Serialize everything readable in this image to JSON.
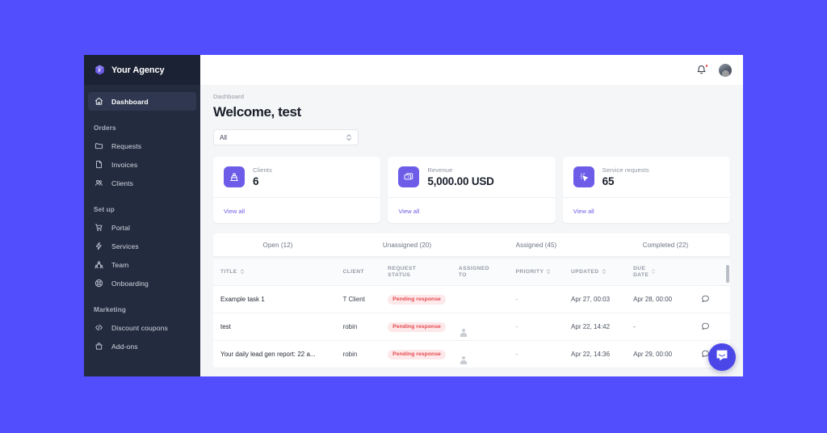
{
  "window": {
    "background_color": "#524EFD",
    "surface_color": "#f5f6f8"
  },
  "sidebar": {
    "brand": {
      "name": "Your Agency",
      "logo_icon": "cube-logo-icon"
    },
    "groups": [
      {
        "section": null,
        "items": [
          {
            "label": "Dashboard",
            "icon": "home-icon",
            "active": true
          }
        ]
      },
      {
        "section": "Orders",
        "items": [
          {
            "label": "Requests",
            "icon": "folder-icon",
            "active": false
          },
          {
            "label": "Invoices",
            "icon": "document-icon",
            "active": false
          },
          {
            "label": "Clients",
            "icon": "users-icon",
            "active": false
          }
        ]
      },
      {
        "section": "Set up",
        "items": [
          {
            "label": "Portal",
            "icon": "cart-icon",
            "active": false
          },
          {
            "label": "Services",
            "icon": "lightning-icon",
            "active": false
          },
          {
            "label": "Team",
            "icon": "team-icon",
            "active": false
          },
          {
            "label": "Onboarding",
            "icon": "lifebuoy-icon",
            "active": false
          }
        ]
      },
      {
        "section": "Marketing",
        "items": [
          {
            "label": "Discount coupons",
            "icon": "code-icon",
            "active": false
          },
          {
            "label": "Add-ons",
            "icon": "bag-icon",
            "active": false
          }
        ]
      }
    ]
  },
  "topbar": {
    "notifications_icon": "bell-icon",
    "has_unread": true,
    "avatar": "user-avatar"
  },
  "page": {
    "breadcrumb": "Dashboard",
    "title": "Welcome, test"
  },
  "filter": {
    "value": "All",
    "placeholder": "All",
    "icon": "chevron-updown-icon"
  },
  "stats": [
    {
      "label": "Clients",
      "value": "6",
      "icon": "clients-icon",
      "link": "View all",
      "accent": "#6c5ce7"
    },
    {
      "label": "Revenue",
      "value": "5,000.00 USD",
      "icon": "revenue-icon",
      "link": "View all",
      "accent": "#6c5ce7"
    },
    {
      "label": "Service requests",
      "value": "65",
      "icon": "service-request-icon",
      "link": "View all",
      "accent": "#6c5ce7"
    }
  ],
  "tabs": [
    {
      "label": "Open (12)",
      "active": false
    },
    {
      "label": "Unassigned (20)",
      "active": false
    },
    {
      "label": "Assigned (45)",
      "active": false
    },
    {
      "label": "Completed (22)",
      "active": false
    }
  ],
  "table": {
    "columns": [
      {
        "label": "TITLE",
        "sortable": true
      },
      {
        "label": "CLIENT",
        "sortable": false
      },
      {
        "label": "REQUEST\nSTATUS",
        "sortable": false
      },
      {
        "label": "ASSIGNED\nTO",
        "sortable": false
      },
      {
        "label": "PRIORITY",
        "sortable": true
      },
      {
        "label": "UPDATED",
        "sortable": true
      },
      {
        "label": "DUE\nDATE",
        "sortable": true
      },
      {
        "label": "",
        "sortable": false
      }
    ],
    "rows": [
      {
        "title": "Example task 1",
        "client": "T Client",
        "status": "Pending response",
        "assigned_to": "",
        "priority": "-",
        "updated": "Apr 27, 00:03",
        "due_date": "Apr 28, 00:00",
        "action_icon": "chat-bubble-icon"
      },
      {
        "title": "test",
        "client": "robin",
        "status": "Pending response",
        "assigned_to": "avatar-placeholder",
        "priority": "-",
        "updated": "Apr 22, 14:42",
        "due_date": "-",
        "action_icon": "chat-bubble-icon"
      },
      {
        "title": "Your daily lead gen report: 22 a...",
        "client": "robin",
        "status": "Pending response",
        "assigned_to": "avatar-placeholder",
        "priority": "-",
        "updated": "Apr 22, 14:36",
        "due_date": "Apr 29, 00:00",
        "action_icon": "chat-bubble-icon"
      }
    ],
    "status_badge_color": "#e5484d",
    "status_badge_background": "#fde8ea"
  },
  "chat_launcher": {
    "icon": "messenger-icon",
    "color": "#4a46e8"
  }
}
